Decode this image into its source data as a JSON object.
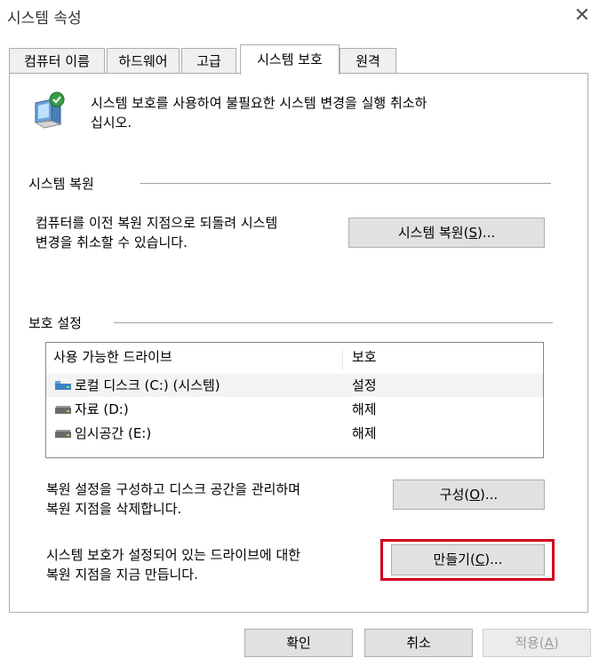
{
  "window": {
    "title": "시스템 속성",
    "close_glyph": "✕"
  },
  "tabs": [
    {
      "label": "컴퓨터 이름",
      "active": false
    },
    {
      "label": "하드웨어",
      "active": false
    },
    {
      "label": "고급",
      "active": false
    },
    {
      "label": "시스템 보호",
      "active": true
    },
    {
      "label": "원격",
      "active": false
    }
  ],
  "intro": {
    "icon": "computer-shield-icon",
    "line1": "시스템 보호를 사용하여 불필요한 시스템 변경을 실행 취소하",
    "line2": "십시오."
  },
  "restore": {
    "section_title": "시스템 복원",
    "desc_line1": "컴퓨터를 이전 복원 지점으로 되돌려 시스템",
    "desc_line2": "변경을 취소할 수 있습니다.",
    "button_pre": "시스템 복원(",
    "button_key": "S",
    "button_post": ")..."
  },
  "protection": {
    "section_title": "보호 설정",
    "columns": {
      "drive": "사용 가능한 드라이브",
      "protection": "보호"
    },
    "drives": [
      {
        "name": "로컬 디스크 (C:) (시스템)",
        "status": "설정",
        "icon": "system-drive-icon"
      },
      {
        "name": "자료 (D:)",
        "status": "해제",
        "icon": "drive-icon"
      },
      {
        "name": "임시공간 (E:)",
        "status": "해제",
        "icon": "drive-icon"
      }
    ],
    "config_line1": "복원 설정을 구성하고 디스크 공간을 관리하며",
    "config_line2": "복원 지점을 삭제합니다.",
    "config_pre": "구성(",
    "config_key": "O",
    "config_post": ")...",
    "create_line1": "시스템 보호가 설정되어 있는 드라이브에 대한",
    "create_line2": "복원 지점을 지금 만듭니다.",
    "create_pre": "만들기(",
    "create_key": "C",
    "create_post": ")..."
  },
  "footer": {
    "ok": "확인",
    "cancel": "취소",
    "apply_pre": "적용(",
    "apply_key": "A",
    "apply_post": ")"
  },
  "colors": {
    "highlight_frame": "#d0021b"
  }
}
